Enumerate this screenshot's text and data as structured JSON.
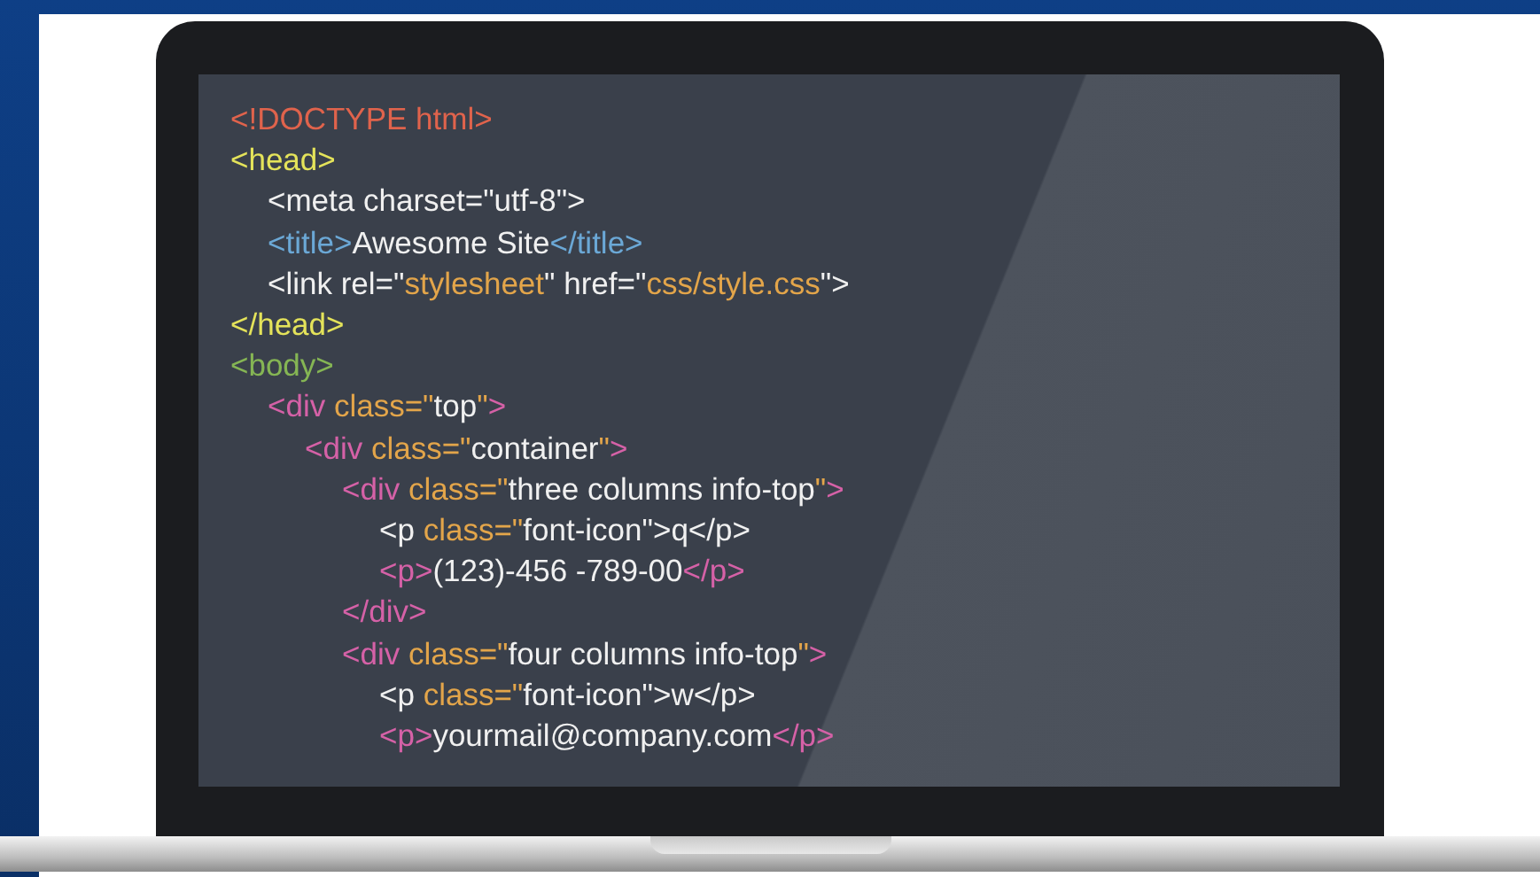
{
  "code_lines": [
    {
      "tokens": [
        {
          "kind": "doctype",
          "text": "<!DOCTYPE html>"
        }
      ]
    },
    {
      "tokens": [
        {
          "kind": "head",
          "text": "<head>"
        }
      ],
      "children": [
        {
          "tokens": [
            {
              "kind": "text",
              "text": "<meta charset=\"utf-8\">"
            }
          ]
        },
        {
          "tokens": [
            {
              "kind": "title",
              "text": "<title>"
            },
            {
              "kind": "text",
              "text": "Awesome Site"
            },
            {
              "kind": "title",
              "text": "</title>"
            }
          ]
        },
        {
          "tokens": [
            {
              "kind": "text",
              "text": "<link rel=\""
            },
            {
              "kind": "value",
              "text": "stylesheet"
            },
            {
              "kind": "text",
              "text": "\" href=\""
            },
            {
              "kind": "value",
              "text": "css/style.css"
            },
            {
              "kind": "text",
              "text": "\">"
            }
          ]
        }
      ]
    },
    {
      "tokens": [
        {
          "kind": "head",
          "text": "</head>"
        }
      ]
    },
    {
      "tokens": [
        {
          "kind": "body",
          "text": "<body>"
        }
      ],
      "children": [
        {
          "tokens": [
            {
              "kind": "tag",
              "text": "<div "
            },
            {
              "kind": "value",
              "text": "class=\""
            },
            {
              "kind": "text",
              "text": "top"
            },
            {
              "kind": "value",
              "text": "\""
            },
            {
              "kind": "tag",
              "text": ">"
            }
          ],
          "children": [
            {
              "tokens": [
                {
                  "kind": "tag",
                  "text": "<div "
                },
                {
                  "kind": "value",
                  "text": "class=\""
                },
                {
                  "kind": "text",
                  "text": "container"
                },
                {
                  "kind": "value",
                  "text": "\""
                },
                {
                  "kind": "tag",
                  "text": ">"
                }
              ],
              "children": [
                {
                  "tokens": [
                    {
                      "kind": "tag",
                      "text": "<div "
                    },
                    {
                      "kind": "value",
                      "text": "class=\""
                    },
                    {
                      "kind": "text",
                      "text": "three columns info-top"
                    },
                    {
                      "kind": "value",
                      "text": "\""
                    },
                    {
                      "kind": "tag",
                      "text": ">"
                    }
                  ],
                  "children": [
                    {
                      "tokens": [
                        {
                          "kind": "text",
                          "text": "<p "
                        },
                        {
                          "kind": "value",
                          "text": "class=\""
                        },
                        {
                          "kind": "text",
                          "text": "font-icon\">q</p>"
                        }
                      ]
                    },
                    {
                      "tokens": [
                        {
                          "kind": "tag",
                          "text": "<p>"
                        },
                        {
                          "kind": "text",
                          "text": "(123)-456 -789-00"
                        },
                        {
                          "kind": "tag",
                          "text": "</p>"
                        }
                      ]
                    }
                  ]
                },
                {
                  "tokens": [
                    {
                      "kind": "tag",
                      "text": "</div>"
                    }
                  ]
                },
                {
                  "tokens": [
                    {
                      "kind": "tag",
                      "text": "<div "
                    },
                    {
                      "kind": "value",
                      "text": "class=\""
                    },
                    {
                      "kind": "text",
                      "text": "four columns info-top"
                    },
                    {
                      "kind": "value",
                      "text": "\""
                    },
                    {
                      "kind": "tag",
                      "text": ">"
                    }
                  ],
                  "children": [
                    {
                      "tokens": [
                        {
                          "kind": "text",
                          "text": "<p "
                        },
                        {
                          "kind": "value",
                          "text": "class=\""
                        },
                        {
                          "kind": "text",
                          "text": "font-icon\">w</p>"
                        }
                      ]
                    },
                    {
                      "tokens": [
                        {
                          "kind": "tag",
                          "text": "<p>"
                        },
                        {
                          "kind": "text",
                          "text": "yourmail@company.com"
                        },
                        {
                          "kind": "tag",
                          "text": "</p>"
                        }
                      ]
                    }
                  ]
                }
              ]
            }
          ]
        }
      ]
    }
  ]
}
